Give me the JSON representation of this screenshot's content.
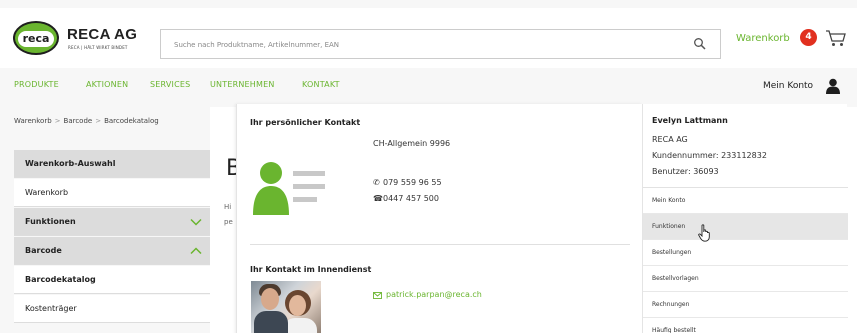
{
  "header": {
    "logo_text": "reca",
    "brand": "RECA AG",
    "brand_sub": "RECA | HÄLT WIRKT BINDET",
    "search_placeholder": "Suche nach Produktname, Artikelnummer, EAN",
    "cart_label": "Warenkorb",
    "cart_count": "4"
  },
  "nav": {
    "items": [
      "PRODUKTE",
      "AKTIONEN",
      "SERVICES",
      "UNTERNEHMEN",
      "KONTAKT"
    ],
    "account_label": "Mein Konto"
  },
  "breadcrumb": [
    "Warenkorb",
    "Barcode",
    "Barcodekatalog"
  ],
  "sidebar": {
    "items": [
      {
        "label": "Warenkorb-Auswahl"
      },
      {
        "label": "Warenkorb"
      },
      {
        "label": "Funktionen"
      },
      {
        "label": "Barcode"
      },
      {
        "label": "Barcodekatalog"
      },
      {
        "label": "Kostenträger"
      }
    ]
  },
  "main": {
    "heading": "B",
    "snippet_1": "Hi",
    "snippet_2": "pe"
  },
  "contact": {
    "personal_title": "Ihr persönlicher Kontakt",
    "personal_name": "CH-Allgemein 9996",
    "phone": "079 559 96 55",
    "fax": "0447 457 500",
    "internal_title": "Ihr Kontakt im Innendienst",
    "email": "patrick.parpan@reca.ch"
  },
  "account": {
    "name": "Evelyn Lattmann",
    "company": "RECA AG",
    "customer_number": "Kundennummer: 233112832",
    "user": "Benutzer: 36093",
    "links": [
      "Mein Konto",
      "Funktionen",
      "Bestellungen",
      "Bestellvorlagen",
      "Rechnungen",
      "Häufig bestellt"
    ]
  },
  "colors": {
    "accent_green": "#6ab52f",
    "badge_red": "#e1301f"
  }
}
